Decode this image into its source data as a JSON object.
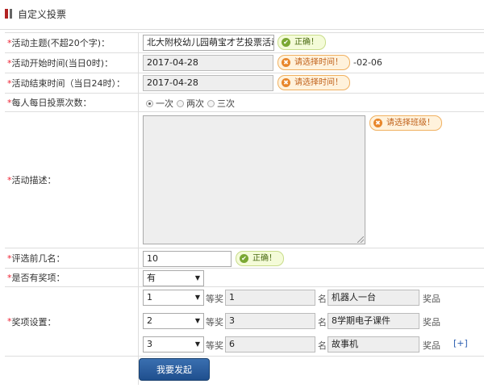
{
  "header": {
    "title": "自定义投票"
  },
  "form": {
    "topic": {
      "label": "活动主题(不超20个字)：",
      "value": "北大附校幼儿园萌宝才艺投票活动",
      "tip": "正确！"
    },
    "start": {
      "label": "活动开始时间(当日0时)：",
      "value": "2017-04-28",
      "tip": "请选择时间！",
      "tail": "-02-06"
    },
    "end": {
      "label": "活动结束时间（当日24时）：",
      "value": "2017-04-28",
      "tip": "请选择时间！"
    },
    "daily": {
      "label": "每人每日投票次数：",
      "options": [
        "一次",
        "两次",
        "三次"
      ],
      "selected": "一次"
    },
    "desc": {
      "label": "活动描述：",
      "tip": "请选择班级！"
    },
    "rank": {
      "label": "评选前几名：",
      "value": "10",
      "tip": "正确！"
    },
    "has_prize": {
      "label": "是否有奖项：",
      "value": "有"
    },
    "prizes": {
      "label": "奖项设置：",
      "deng": "等奖",
      "ming": "名",
      "jiangpin": "奖品",
      "add": "[+]",
      "rows": [
        {
          "level": "1",
          "count": "1",
          "item": "机器人一台"
        },
        {
          "level": "2",
          "count": "3",
          "item": "8学期电子课件"
        },
        {
          "level": "3",
          "count": "6",
          "item": "故事机"
        }
      ]
    },
    "submit": "我要发起"
  },
  "colors": {
    "accent": "#b22222",
    "ok": "#7aa832",
    "warn": "#e8862a",
    "button": "#1f4f8e"
  }
}
